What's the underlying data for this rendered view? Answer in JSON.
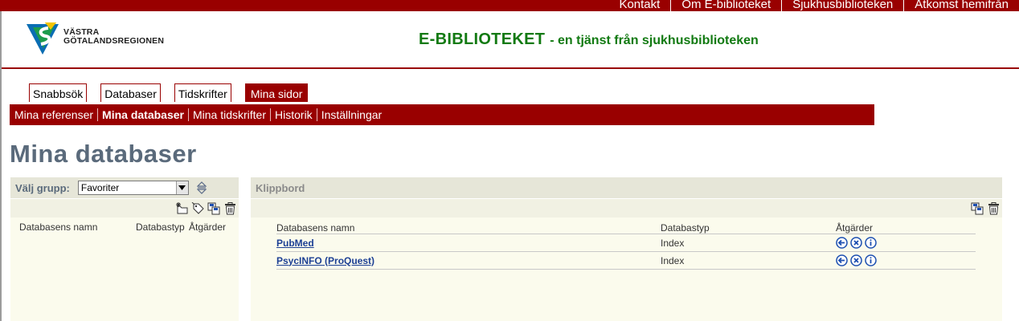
{
  "top_links": [
    "Kontakt",
    "Om E-biblioteket",
    "Sjukhusbiblioteken",
    "Åtkomst hemifrån"
  ],
  "logo": {
    "line1": "VÄSTRA",
    "line2": "GÖTALANDSREGIONEN"
  },
  "site": {
    "title": "E-BIBLIOTEKET",
    "subtitle": "- en tjänst från sjukhusbiblioteken"
  },
  "tabs": [
    {
      "label": "Snabbsök",
      "active": false
    },
    {
      "label": "Databaser",
      "active": false
    },
    {
      "label": "Tidskrifter",
      "active": false
    },
    {
      "label": "Mina sidor",
      "active": true
    }
  ],
  "subnav": [
    {
      "label": "Mina referenser",
      "active": false
    },
    {
      "label": "Mina databaser",
      "active": true
    },
    {
      "label": "Mina tidskrifter",
      "active": false
    },
    {
      "label": "Historik",
      "active": false
    },
    {
      "label": "Inställningar",
      "active": false
    }
  ],
  "page_title": "Mina databaser",
  "left_panel": {
    "group_label": "Välj grupp:",
    "group_selected": "Favoriter",
    "columns": [
      "Databasens namn",
      "Databastyp",
      "Åtgärder"
    ]
  },
  "clipboard": {
    "title": "Klippbord",
    "columns": [
      "Databasens namn",
      "Databastyp",
      "Åtgärder"
    ],
    "rows": [
      {
        "name": "PubMed",
        "type": "Index"
      },
      {
        "name": "PsycINFO (ProQuest)",
        "type": "Index"
      }
    ]
  },
  "colors": {
    "brand_red": "#990000",
    "title_green": "#127a12",
    "heading_slate": "#5a6a7b",
    "link_blue": "#1c3f94",
    "action_blue": "#1c4fb0"
  },
  "icons": [
    "sort-arrows-icon",
    "new-group-icon",
    "tag-icon",
    "copy-icon",
    "trash-icon",
    "back-arrow-icon",
    "remove-circle-icon",
    "info-icon"
  ]
}
